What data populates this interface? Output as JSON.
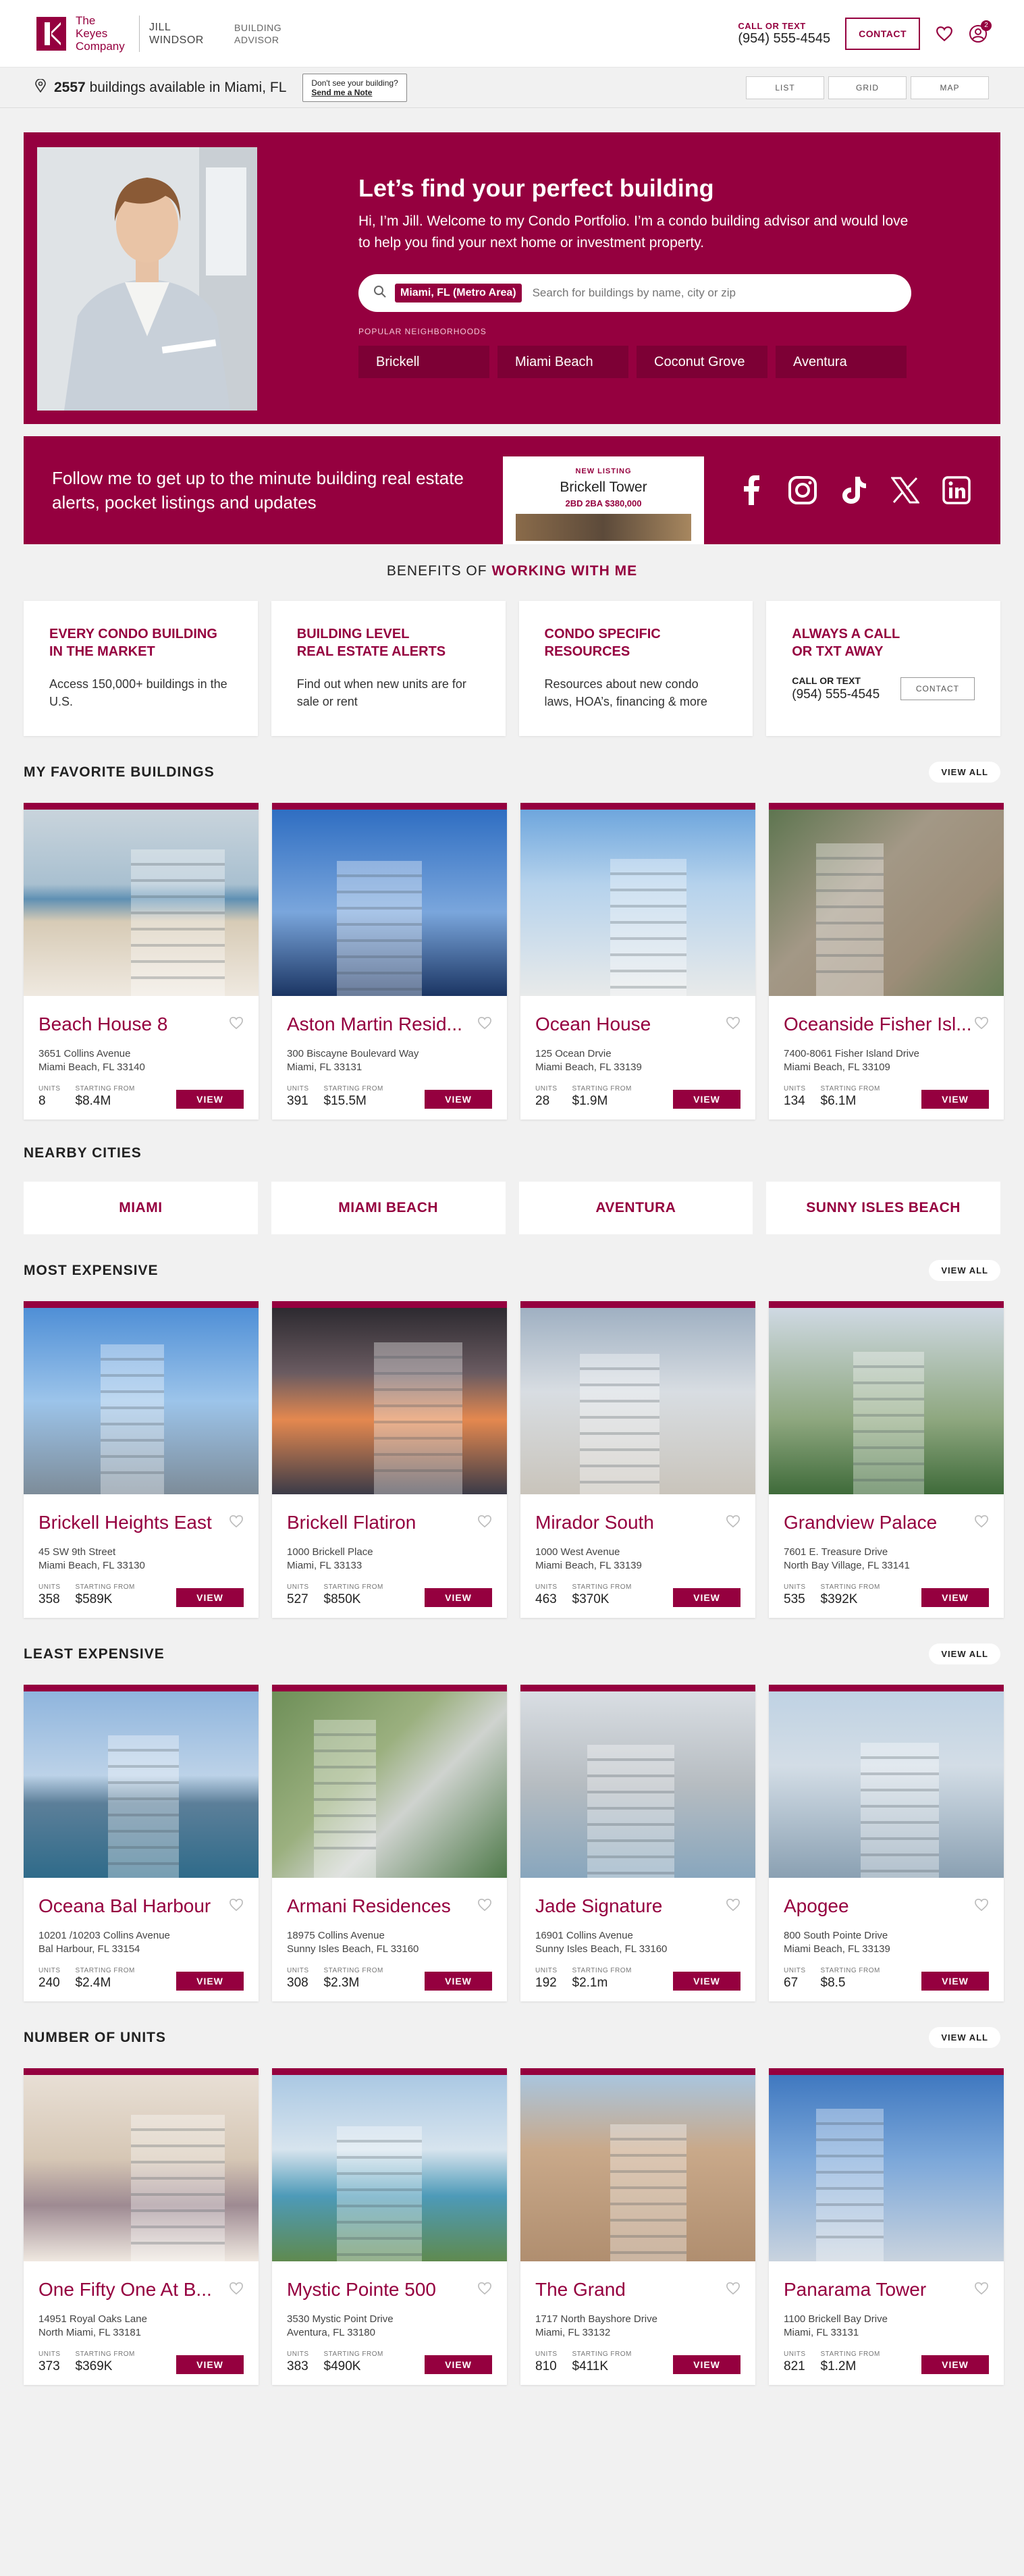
{
  "header": {
    "logo_text": "The Keyes Company",
    "agent_name": "JILL WINDSOR",
    "agent_role": "BUILDING ADVISOR",
    "call_label": "CALL OR TEXT",
    "phone": "(954) 555-4545",
    "contact_label": "CONTACT",
    "profile_badge": "2"
  },
  "subbar": {
    "count": "2557",
    "count_suffix": "buildings available in Miami, FL",
    "note_line1": "Don't see your building?",
    "note_line2": "Send me a Note",
    "views": [
      "LIST",
      "GRID",
      "MAP"
    ]
  },
  "hero": {
    "title": "Let’s find your perfect building",
    "intro": "Hi, I’m Jill. Welcome to my Condo Portfolio.  I’m a condo building advisor and would love to help you find your next home or investment property.",
    "chip": "Miami, FL (Metro Area)",
    "search_placeholder": "Search for buildings by name, city or zip",
    "popular_label": "POPULAR NEIGHBORHOODS",
    "neighborhoods": [
      "Brickell",
      "Miami Beach",
      "Coconut Grove",
      "Aventura"
    ]
  },
  "follow": {
    "text": "Follow me to get up to the minute building real estate alerts, pocket listings and updates",
    "listing_tag": "NEW LISTING",
    "listing_name": "Brickell Tower",
    "listing_info": "2BD 2BA  $380,000",
    "socials": [
      "facebook-icon",
      "instagram-icon",
      "tiktok-icon",
      "x-icon",
      "linkedin-icon"
    ]
  },
  "benefits": {
    "title_prefix": "BENEFITS OF",
    "title_accent": "WORKING WITH ME",
    "items": [
      {
        "heading_1": "EVERY CONDO BUILDING",
        "heading_2": "IN THE MARKET",
        "text": "Access 150,000+ buildings in the U.S."
      },
      {
        "heading_1": "BUILDING LEVEL",
        "heading_2": "REAL ESTATE ALERTS",
        "text": "Find out when new units are for sale or rent"
      },
      {
        "heading_1": "CONDO SPECIFIC",
        "heading_2": "RESOURCES",
        "text": "Resources about new condo laws, HOA’s, financing & more"
      },
      {
        "heading_1": "ALWAYS A CALL",
        "heading_2": "OR TXT AWAY",
        "call_label": "CALL OR TEXT",
        "phone": "(954) 555-4545",
        "button": "CONTACT"
      }
    ]
  },
  "labels": {
    "view_all": "VIEW ALL",
    "units": "UNITS",
    "starting_from": "STARTING FROM",
    "view": "VIEW"
  },
  "favorites": {
    "title": "MY FAVORITE BUILDINGS",
    "cards": [
      {
        "name": "Beach House 8",
        "addr1": "3651 Collins Avenue",
        "addr2": "Miami Beach, FL 33140",
        "units": "8",
        "price": "$8.4M"
      },
      {
        "name": "Aston Martin Resid...",
        "addr1": "300 Biscayne Boulevard Way",
        "addr2": "Miami, FL 33131",
        "units": "391",
        "price": "$15.5M"
      },
      {
        "name": "Ocean House",
        "addr1": "125 Ocean Drvie",
        "addr2": "Miami Beach, FL 33139",
        "units": "28",
        "price": "$1.9M"
      },
      {
        "name": "Oceanside Fisher Isl...",
        "addr1": "7400-8061 Fisher Island Drive",
        "addr2": "Miami Beach, FL 33109",
        "units": "134",
        "price": "$6.1M"
      }
    ]
  },
  "nearby": {
    "title": "NEARBY CITIES",
    "cities": [
      "MIAMI",
      "MIAMI BEACH",
      "AVENTURA",
      "SUNNY ISLES BEACH"
    ]
  },
  "most_expensive": {
    "title": "MOST EXPENSIVE",
    "cards": [
      {
        "name": "Brickell Heights East",
        "addr1": "45 SW 9th Street",
        "addr2": "Miami Beach, FL 33130",
        "units": "358",
        "price": "$589K"
      },
      {
        "name": "Brickell Flatiron",
        "addr1": "1000 Brickell Place",
        "addr2": "Miami, FL 33133",
        "units": "527",
        "price": "$850K"
      },
      {
        "name": "Mirador South",
        "addr1": "1000 West Avenue",
        "addr2": "Miami Beach, FL 33139",
        "units": "463",
        "price": "$370K"
      },
      {
        "name": "Grandview Palace",
        "addr1": "7601 E. Treasure Drive",
        "addr2": "North Bay Village, FL 33141",
        "units": "535",
        "price": "$392K"
      }
    ]
  },
  "least_expensive": {
    "title": "LEAST EXPENSIVE",
    "cards": [
      {
        "name": "Oceana Bal Harbour",
        "addr1": "10201 /10203 Collins Avenue",
        "addr2": "Bal Harbour, FL 33154",
        "units": "240",
        "price": "$2.4M"
      },
      {
        "name": "Armani Residences",
        "addr1": "18975 Collins Avenue",
        "addr2": "Sunny Isles Beach, FL 33160",
        "units": "308",
        "price": "$2.3M"
      },
      {
        "name": "Jade Signature",
        "addr1": "16901 Collins Avenue",
        "addr2": "Sunny Isles Beach, FL 33160",
        "units": "192",
        "price": "$2.1m"
      },
      {
        "name": "Apogee",
        "addr1": "800 South Pointe Drive",
        "addr2": "Miami Beach, FL 33139",
        "units": "67",
        "price": "$8.5"
      }
    ]
  },
  "num_units": {
    "title": "NUMBER OF UNITS",
    "cards": [
      {
        "name": "One Fifty One At B...",
        "addr1": "14951 Royal Oaks Lane",
        "addr2": "North Miami, FL 33181",
        "units": "373",
        "price": "$369K"
      },
      {
        "name": "Mystic Pointe 500",
        "addr1": "3530 Mystic Point Drive",
        "addr2": "Aventura, FL 33180",
        "units": "383",
        "price": "$490K"
      },
      {
        "name": "The Grand",
        "addr1": "1717 North Bayshore Drive",
        "addr2": "Miami, FL 33132",
        "units": "810",
        "price": "$411K"
      },
      {
        "name": "Panarama Tower",
        "addr1": "1100 Brickell Bay Drive",
        "addr2": "Miami, FL 33131",
        "units": "821",
        "price": "$1.2M"
      }
    ]
  },
  "colors": {
    "brand": "#95003f",
    "brand_dark": "#7d0035",
    "background": "#f1f1f1"
  }
}
